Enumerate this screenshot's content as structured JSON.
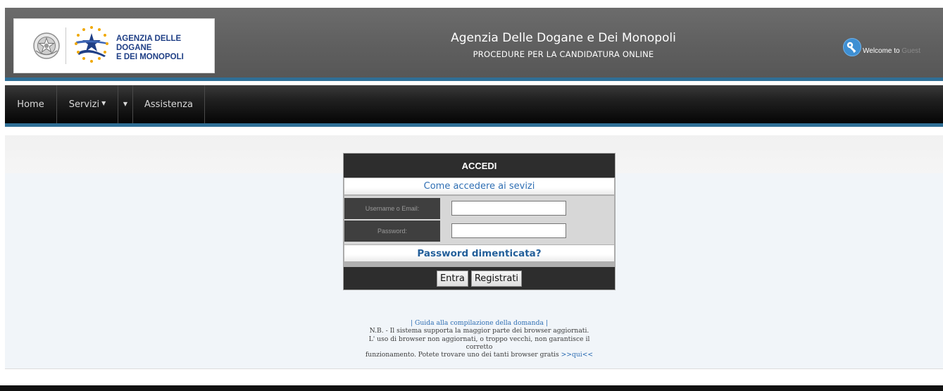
{
  "header": {
    "logo_line1": "AGENZIA DELLE DOGANE",
    "logo_line2": "E DEI MONOPOLI",
    "title": "Agenzia Delle Dogane e Dei Monopoli",
    "subtitle": "PROCEDURE PER LA CANDIDATURA ONLINE",
    "welcome_label": "Welcome to",
    "welcome_user": "Guest",
    "icons": {
      "emblem": "italian-republic-emblem-icon",
      "logo_mark": "eu-stars-icon",
      "user": "key-icon"
    }
  },
  "nav": {
    "items": [
      {
        "label": "Home"
      },
      {
        "label": "Servizi"
      },
      {
        "label": "Assistenza"
      }
    ],
    "caret_icon": "caret-down-icon"
  },
  "login": {
    "title": "ACCEDI",
    "how_to_access": "Come accedere ai sevizi",
    "username_label": "Username o Email:",
    "username_value": "",
    "password_label": "Password:",
    "password_value": "",
    "forgot_password": "Password dimenticata?",
    "enter_button": "Entra",
    "register_button": "Registrati"
  },
  "notes": {
    "guide_link": "| Guida alla compilazione della domanda |",
    "line1": "N.B. - Il sistema supporta la maggior parte dei browser aggiornati.",
    "line2": "L' uso di browser non aggiornati, o troppo vecchi, non garantisce il",
    "line3": "corretto",
    "line4": "funzionamento. Potete trovare uno dei tanti browser gratis",
    "here_link": ">>qui<<"
  },
  "colors": {
    "header_bg": "#5f5f5f",
    "accent_rule": "#2f6f96",
    "nav_bg": "#111111",
    "panel_dark": "#2d2d2d",
    "link_blue": "#2e6eb3",
    "logo_blue": "#1f3f86",
    "body_bg": "#f1f5f9"
  }
}
